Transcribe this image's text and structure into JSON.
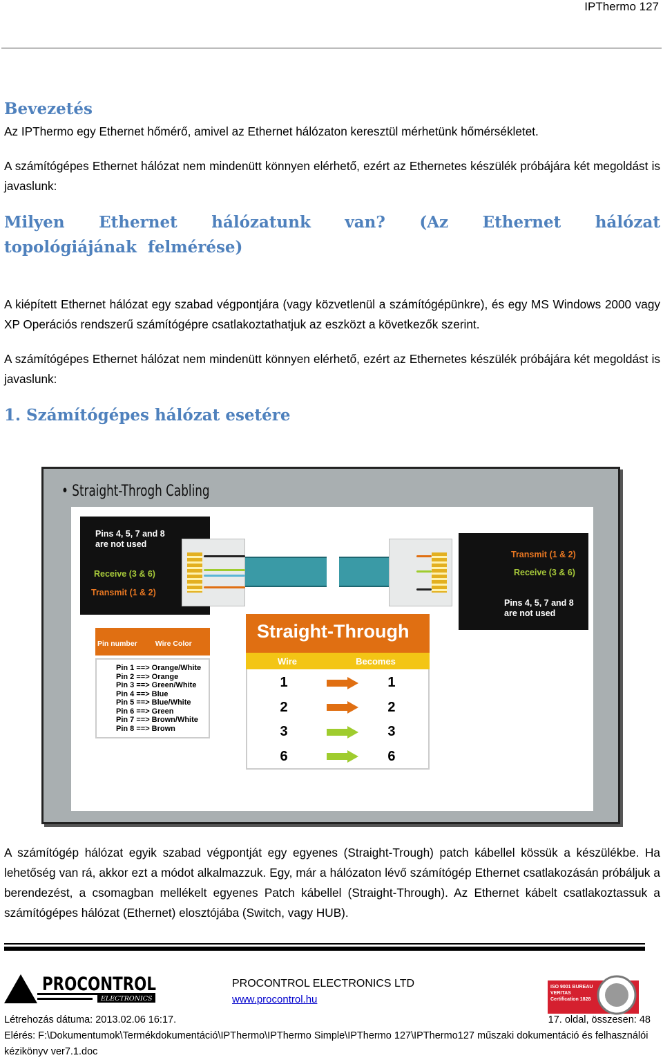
{
  "header": {
    "title": "IPThermo 127"
  },
  "sections": [
    {
      "heading": "Bevezetés"
    },
    {
      "heading": "Milyen Ethernet hálózatunk van? (Az Ethernet hálózat topológiájának felmérése)"
    },
    {
      "heading": "1. Számítógépes hálózat esetére"
    }
  ],
  "paragraphs": [
    "Az IPThermo egy Ethernet hőmérő, amivel az Ethernet hálózaton keresztül mérhetünk hőmérsékletet.",
    "A számítógépes Ethernet hálózat nem mindenütt könnyen elérhető, ezért az Ethernetes készülék próbájára két megoldást is javaslunk:",
    "A kiépített Ethernet hálózat egy szabad végpontjára (vagy közvetlenül a számítógépünkre), és egy MS Windows 2000 vagy XP Operációs rendszerű számítógépre csatlakoztathatjuk az eszközt a következők szerint.",
    "A számítógépes Ethernet hálózat nem mindenütt könnyen elérhető, ezért az Ethernetes készülék próbájára két megoldást is javaslunk:",
    "A számítógép hálózat egyik szabad végpontját egy egyenes (Straight-Trough) patch kábellel kössük a készülékbe. Ha lehetőség van rá, akkor ezt a módot alkalmazzuk. Egy, már a hálózaton lévő számítógép Ethernet csatlakozásán próbáljuk a berendezést, a csomagban mellékelt egyenes Patch kábellel (Straight-Through). Az Ethernet kábelt csatlakoztassuk a számítógépes hálózat (Ethernet) elosztójába (Switch, vagy HUB)."
  ],
  "figure": {
    "title": "• Straight-Throgh Cabling",
    "left": {
      "not_used": "Pins 4, 5, 7 and 8 are not used",
      "receive": "Receive (3 & 6)",
      "transmit": "Transmit (1 & 2)"
    },
    "right": {
      "not_used": "Pins 4, 5, 7 and 8 are not used",
      "receive": "Receive (3 & 6)",
      "transmit": "Transmit (1 & 2)"
    },
    "pin_table": {
      "col1": "Pin number",
      "col2": "Wire Color",
      "rows": [
        "Pin 1 ==> Orange/White",
        "Pin 2 ==> Orange",
        "Pin 3 ==> Green/White",
        "Pin 4 ==> Blue",
        "Pin 5 ==> Blue/White",
        "Pin 6 ==> Green",
        "Pin 7 ==> Brown/White",
        "Pin 8 ==> Brown"
      ]
    },
    "straight": {
      "title": "Straight-Through",
      "col1": "Wire",
      "col2": "Becomes",
      "rows": [
        {
          "wire": "1",
          "becomes": "1",
          "color": "#e06f12"
        },
        {
          "wire": "2",
          "becomes": "2",
          "color": "#e06f12"
        },
        {
          "wire": "3",
          "becomes": "3",
          "color": "#9fcc2e"
        },
        {
          "wire": "6",
          "becomes": "6",
          "color": "#9fcc2e"
        }
      ]
    }
  },
  "footer": {
    "logo_text": "PROCONTROL ELECTRONICS",
    "company": "PROCONTROL ELECTRONICS LTD",
    "website": "www.procontrol.hu",
    "cert_text": "ISO 9001 BUREAU VERITAS Certification 1828",
    "created": "Létrehozás dátuma: 2013.02.06 16:17.",
    "page": "17. oldal, összesen: 48",
    "path": "Elérés: F:\\Dokumentumok\\Termékdokumentáció\\IPThermo\\IPThermo Simple\\IPThermo 127\\IPThermo127 műszaki dokumentáció és felhasználói kézikönyv ver7.1.doc"
  },
  "colors": {
    "heading": "#4f81bd",
    "orange": "#e06f12",
    "yellow": "#f3c515",
    "green": "#9fcc2e",
    "cert_red": "#d5202f"
  }
}
